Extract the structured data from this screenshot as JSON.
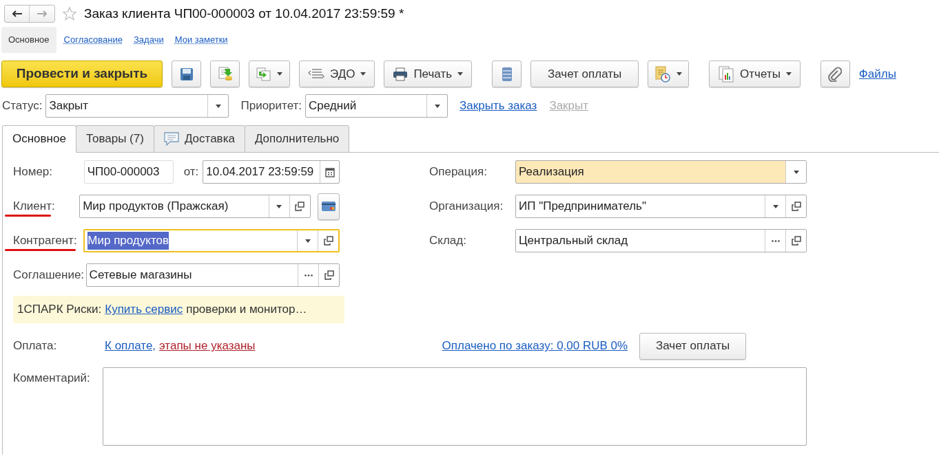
{
  "window": {
    "title": "Заказ клиента ЧП00-000003 от 10.04.2017 23:59:59 *",
    "favorite": false
  },
  "nav": [
    {
      "label": "Основное",
      "selected": true
    },
    {
      "label": "Согласование",
      "selected": false
    },
    {
      "label": "Задачи",
      "selected": false
    },
    {
      "label": "Мои заметки",
      "selected": false
    }
  ],
  "toolbar": [
    {
      "kind": "primary",
      "label": "Провести и закрыть"
    },
    {
      "kind": "icon"
    },
    {
      "kind": "icon"
    },
    {
      "kind": "icon-dropdown"
    },
    {
      "kind": "text-dropdown",
      "label": "ЭДО"
    },
    {
      "kind": "text-dropdown",
      "label": "Печать"
    },
    {
      "kind": "icon"
    },
    {
      "kind": "text",
      "label": "Зачет оплаты"
    },
    {
      "kind": "icon-dropdown"
    },
    {
      "kind": "text-dropdown",
      "label": "Отчеты"
    },
    {
      "kind": "icon"
    },
    {
      "kind": "link",
      "label": "Файлы"
    }
  ],
  "status": {
    "label": "Статус:",
    "value": "Закрыт",
    "priority_label": "Приоритет:",
    "priority_value": "Средний",
    "close_link": "Закрыть заказ",
    "closed_link": {
      "label": "Закрыт",
      "disabled": true
    }
  },
  "tabs": [
    {
      "label": "Основное",
      "selected": true,
      "has_icon": false
    },
    {
      "label": "Товары (7)",
      "selected": false,
      "has_icon": false
    },
    {
      "label": "Доставка",
      "selected": false,
      "has_icon": true
    },
    {
      "label": "Дополнительно",
      "selected": false,
      "has_icon": false
    }
  ],
  "left_fields": [
    {
      "kind": "number",
      "label": "Номер:",
      "value": "ЧП00-000003",
      "date_label": "от:",
      "date_value": "10.04.2017 23:59:59",
      "annotated": false
    },
    {
      "kind": "dropdown-open-card",
      "label": "Клиент:",
      "value": "Мир продуктов (Пражская)",
      "annotated": true,
      "focused": false
    },
    {
      "kind": "dropdown-open",
      "label": "Контрагент:",
      "value": "Мир продуктов",
      "annotated": true,
      "focused": true
    },
    {
      "kind": "choice-open",
      "label": "Соглашение:",
      "value": "Сетевые магазины",
      "annotated": false,
      "focused": false
    }
  ],
  "right_fields": [
    {
      "kind": "dropdown",
      "label": "Операция:",
      "value": "Реализация",
      "highlighted": true
    },
    {
      "kind": "dropdown-open",
      "label": "Организация:",
      "value": "ИП \"Предприниматель\"",
      "highlighted": false
    },
    {
      "kind": "choice-open",
      "label": "Склад:",
      "value": "Центральный склад",
      "highlighted": false
    }
  ],
  "spark": {
    "prefix": "1СПАРК Риски:",
    "link": "Купить сервис",
    "suffix": "проверки и монитор…"
  },
  "payment": {
    "label": "Оплата:",
    "link": "К оплате,",
    "warning": "этапы не указаны",
    "paid_link": "Оплачено по заказу: 0,00 RUB 0%",
    "button": "Зачет оплаты"
  },
  "comment": {
    "label": "Комментарий:"
  }
}
